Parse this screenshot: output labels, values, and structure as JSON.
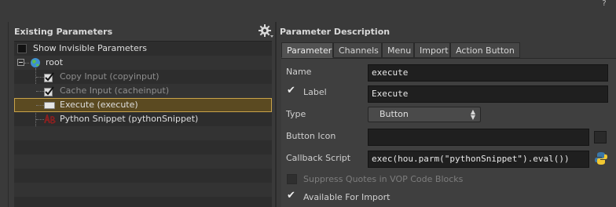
{
  "help": {
    "icon": "help-icon",
    "glyph": "?"
  },
  "existing": {
    "title": "Existing Parameters",
    "show_invisible_label": "Show Invisible Parameters",
    "tree": [
      {
        "label": "root",
        "style": "bright",
        "icon": "globe-icon"
      },
      {
        "label": "Copy Input (copyinput)",
        "style": "dim",
        "icon": "toggle-icon"
      },
      {
        "label": "Cache Input (cacheinput)",
        "style": "dim",
        "icon": "toggle-icon"
      },
      {
        "label": "Execute (execute)",
        "style": "bright",
        "icon": "button-icon",
        "selected": true
      },
      {
        "label": "Python Snippet (pythonSnippet)",
        "style": "bright",
        "icon": "string-icon"
      }
    ]
  },
  "description": {
    "title": "Parameter Description",
    "tabs": [
      "Parameter",
      "Channels",
      "Menu",
      "Import",
      "Action Button"
    ],
    "active_tab": "Parameter",
    "name_label": "Name",
    "name_value": "execute",
    "label_label": "Label",
    "label_value": "Execute",
    "type_label": "Type",
    "type_value": "Button",
    "button_icon_label": "Button Icon",
    "button_icon_value": "",
    "callback_label": "Callback Script",
    "callback_value": "exec(hou.parm(\"pythonSnippet\").eval())",
    "suppress_label": "Suppress Quotes in VOP Code Blocks",
    "import_label": "Available For Import"
  }
}
